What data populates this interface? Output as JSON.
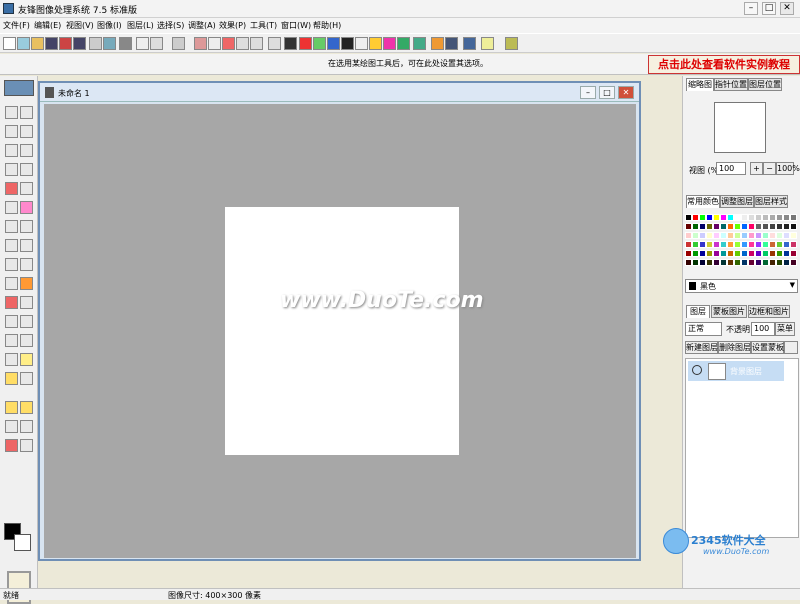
{
  "window": {
    "title": "友锋图像处理系统 7.5 标准版",
    "minimize": "–",
    "maximize": "□",
    "close": "✕"
  },
  "menu": [
    "文件(F)",
    "编辑(E)",
    "视图(V)",
    "图像(I)",
    "图层(L)",
    "选择(S)",
    "调整(A)",
    "效果(P)",
    "工具(T)",
    "窗口(W)",
    "帮助(H)"
  ],
  "hint": "在选用某绘图工具后，可在此处设置其选项。",
  "promo": "点击此处查看软件实例教程",
  "document": {
    "title": "未命名 1",
    "minimize": "–",
    "maximize": "□",
    "close": "✕"
  },
  "watermark": "www.DuoTe.com",
  "navigator": {
    "tabs": [
      "缩略图",
      "指针位置",
      "图层位置"
    ],
    "zoom_label": "视图 (%)",
    "zoom_value": "100",
    "zoom_in": "+",
    "zoom_out": "−",
    "zoom_100": "100%"
  },
  "colors": {
    "tabs": [
      "常用颜色",
      "调整图层",
      "图层样式"
    ],
    "current_color_name": "黑色",
    "current_color": "#000000"
  },
  "layers": {
    "tabs": [
      "图层",
      "蒙板图片",
      "边框和图片"
    ],
    "blend_mode": "正常",
    "opacity_label": "不透明",
    "opacity_value": "100",
    "menu_button": "菜单",
    "buttons": [
      "新建图层",
      "删除图层",
      "设置蒙板"
    ],
    "layer_name": "背景图层"
  },
  "status": {
    "left": "就绪",
    "image_size": "图像尺寸: 400×300 像素"
  },
  "corner_logo": {
    "text": "2345软件大全",
    "url": "www.DuoTe.com"
  }
}
